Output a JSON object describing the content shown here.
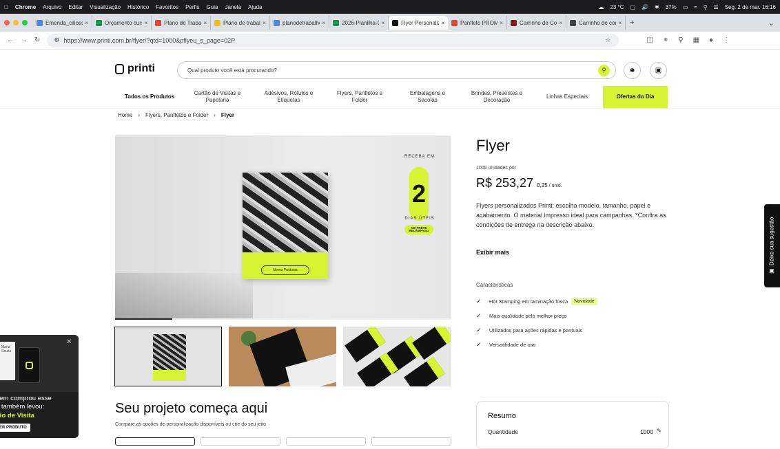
{
  "menubar": {
    "app": "Chrome",
    "items": [
      "Arquivo",
      "Editar",
      "Visualização",
      "Histórico",
      "Favoritos",
      "Perfis",
      "Guia",
      "Janela",
      "Ajuda"
    ],
    "weather": "23 °C",
    "battery": "37%",
    "clock": "Seg. 2 de mar. 16:16"
  },
  "tabs": [
    {
      "title": "Emenda_ciliosso",
      "color": "#4a86e8"
    },
    {
      "title": "Orçamento curso",
      "color": "#0f9d58"
    },
    {
      "title": "Plano de Trabalh",
      "color": "#ea4335"
    },
    {
      "title": "Plano de trabalho",
      "color": "#fbbc04"
    },
    {
      "title": "planodetrabalho-",
      "color": "#4a86e8"
    },
    {
      "title": "2026-Planilha-O",
      "color": "#0f9d58"
    },
    {
      "title": "Flyer Personaliza",
      "color": "#111111"
    },
    {
      "title": "Panfleto PROMOC",
      "color": "#e94235"
    },
    {
      "title": "Carrinho de Com",
      "color": "#8b1a1a"
    },
    {
      "title": "Carrinho de com",
      "color": "#444444"
    }
  ],
  "active_tab_index": 6,
  "url": "https://www.printi.com.br/flyer/?qtd=1000&pflyeu_s_page=02P",
  "header": {
    "logo": "printi",
    "search_placeholder": "Qual produto você está procurando?"
  },
  "categories": [
    {
      "label": "Todos os Produtos",
      "style": "bold"
    },
    {
      "label": "Cartão de Visitas e Papelaria"
    },
    {
      "label": "Adesivos, Rótulos e Etiquetas"
    },
    {
      "label": "Flyers, Panfletos e Folder"
    },
    {
      "label": "Embalagens e Sacolas"
    },
    {
      "label": "Brindes, Presentes e Decoração"
    },
    {
      "label": "Linhas Especiais"
    },
    {
      "label": "Ofertas do Dia",
      "style": "deal"
    }
  ],
  "breadcrumb": [
    "Home",
    "Flyers, Panfletos e Folder",
    "Flyer"
  ],
  "hero": {
    "badge_top": "RECEBA EM",
    "badge_number": "2",
    "badge_bottom": "DIAS ÚTEIS",
    "badge_tag": "NO FRETE RELÂMPAGO",
    "pill": "Novos Produtos",
    "carousel_progress": 0.17
  },
  "product": {
    "title": "Flyer",
    "unit_note": "1000 unidades por",
    "price": "R$ 253,27",
    "unit_price": "0,25",
    "unit_suffix": "/ unid.",
    "description": "Flyers personalizados Printi: escolha modelo, tamanho, papel e acabamento. O material impresso ideal para campanhas. *Confira as condições de entrega na descrição abaixo.",
    "show_more": "Exibir mais",
    "features_title": "Características",
    "features": [
      {
        "text": "Hot Stamping em laminação fosca",
        "badge": "Novidade"
      },
      {
        "text": "Mais qualidade pelo melhor preço"
      },
      {
        "text": "Utilizados para ações rápidas e pontuais"
      },
      {
        "text": "Versatilidade de uso"
      }
    ]
  },
  "popup": {
    "device_text": "Maria Souza",
    "line1": "uem comprou esse",
    "line2": "o também levou:",
    "product": "tão de Visita",
    "cta": "ER PRODUTO"
  },
  "project": {
    "title": "Seu projeto começa aqui",
    "subtitle": "Compare as opções de personalização disponíveis ou crie do seu jeito"
  },
  "summary": {
    "title": "Resumo",
    "qty_label": "Quantidade",
    "qty_value": "1000"
  },
  "feedback_tab": "Deixe sua sugestão",
  "colors": {
    "accent": "#d6f431",
    "text": "#111111"
  }
}
